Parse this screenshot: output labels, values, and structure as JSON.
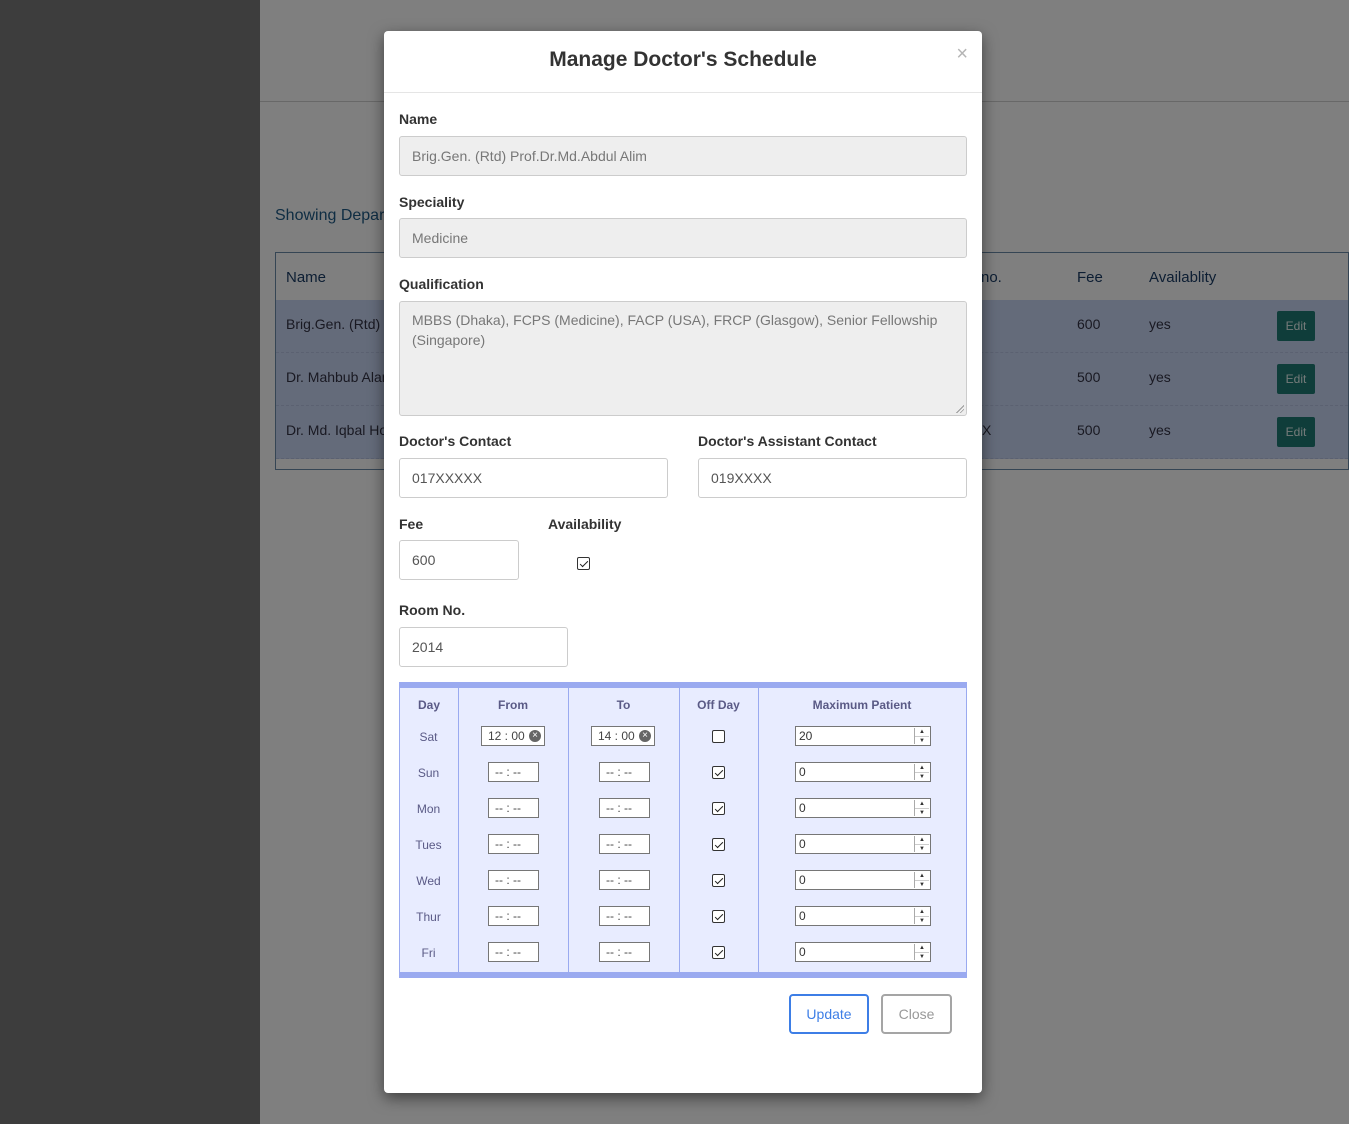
{
  "background": {
    "showing_text": "Showing Depar",
    "table": {
      "headers": [
        "Name",
        "no.",
        "Fee",
        "Availablity"
      ],
      "rows": [
        {
          "name": "Brig.Gen. (Rtd) P",
          "contact_tail": "",
          "fee": "600",
          "availability": "yes",
          "edit": "Edit"
        },
        {
          "name": "Dr. Mahbub Alam",
          "contact_tail": "",
          "fee": "500",
          "availability": "yes",
          "edit": "Edit"
        },
        {
          "name": "Dr. Md. Iqbal Ho",
          "contact_tail": "X",
          "fee": "500",
          "availability": "yes",
          "edit": "Edit"
        }
      ]
    }
  },
  "modal": {
    "title": "Manage Doctor's Schedule",
    "close_glyph": "×",
    "name": {
      "label": "Name",
      "value": "Brig.Gen. (Rtd) Prof.Dr.Md.Abdul Alim"
    },
    "speciality": {
      "label": "Speciality",
      "value": "Medicine"
    },
    "qualification": {
      "label": "Qualification",
      "value": "MBBS (Dhaka), FCPS (Medicine), FACP (USA), FRCP (Glasgow), Senior Fellowship (Singapore)"
    },
    "doctor_contact": {
      "label": "Doctor's Contact",
      "value": "017XXXXX"
    },
    "assistant_contact": {
      "label": "Doctor's Assistant Contact",
      "value": "019XXXX"
    },
    "fee": {
      "label": "Fee",
      "value": "600"
    },
    "availability": {
      "label": "Availability",
      "checked": true
    },
    "room": {
      "label": "Room No.",
      "value": "2014"
    },
    "schedule": {
      "headers": {
        "day": "Day",
        "from": "From",
        "to": "To",
        "off_day": "Off Day",
        "max_patient": "Maximum Patient"
      },
      "rows": [
        {
          "day": "Sat",
          "from": "12 : 00",
          "to": "14 : 00",
          "off": false,
          "max": "20"
        },
        {
          "day": "Sun",
          "from": "-- : --",
          "to": "-- : --",
          "off": true,
          "max": "0"
        },
        {
          "day": "Mon",
          "from": "-- : --",
          "to": "-- : --",
          "off": true,
          "max": "0"
        },
        {
          "day": "Tues",
          "from": "-- : --",
          "to": "-- : --",
          "off": true,
          "max": "0"
        },
        {
          "day": "Wed",
          "from": "-- : --",
          "to": "-- : --",
          "off": true,
          "max": "0"
        },
        {
          "day": "Thur",
          "from": "-- : --",
          "to": "-- : --",
          "off": true,
          "max": "0"
        },
        {
          "day": "Fri",
          "from": "-- : --",
          "to": "-- : --",
          "off": true,
          "max": "0"
        }
      ]
    },
    "buttons": {
      "update": "Update",
      "close": "Close"
    }
  }
}
